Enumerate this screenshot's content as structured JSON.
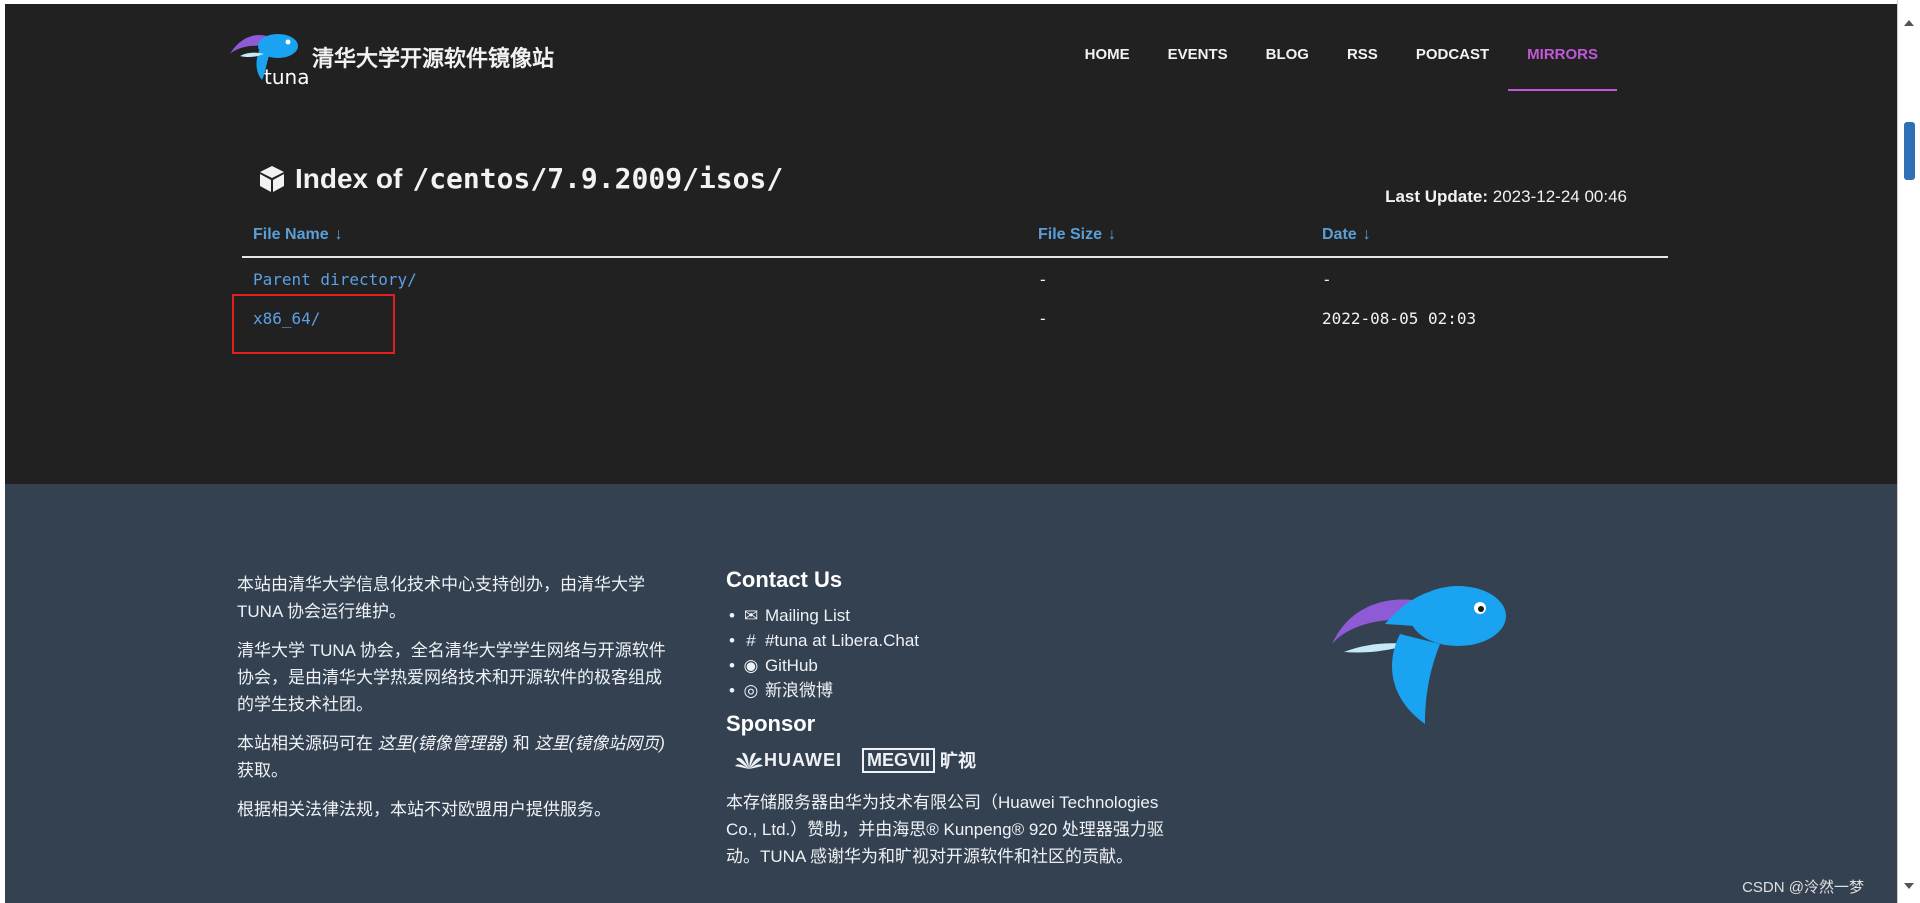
{
  "header": {
    "brand_title": "清华大学开源软件镜像站",
    "logo_text": "tuna",
    "nav": [
      {
        "label": "HOME"
      },
      {
        "label": "EVENTS"
      },
      {
        "label": "BLOG"
      },
      {
        "label": "RSS"
      },
      {
        "label": "PODCAST"
      },
      {
        "label": "MIRRORS",
        "active": true
      }
    ]
  },
  "index": {
    "label": "Index of",
    "path": "/centos/7.9.2009/isos/",
    "last_update_label": "Last Update:",
    "last_update_value": "2023-12-24 00:46"
  },
  "table": {
    "columns": [
      "File Name",
      "File Size",
      "Date"
    ],
    "sort_arrow": "↓",
    "rows": [
      {
        "name": "Parent directory/",
        "size": "-",
        "date": "-"
      },
      {
        "name": "x86_64/",
        "size": "-",
        "date": "2022-08-05 02:03"
      }
    ]
  },
  "footer": {
    "about": {
      "p1": "本站由清华大学信息化技术中心支持创办，由清华大学 TUNA 协会运行维护。",
      "p2": "清华大学 TUNA 协会，全名清华大学学生网络与开源软件协会，是由清华大学热爱网络技术和开源软件的极客组成的学生技术社团。",
      "p3_prefix": "本站相关源码可在",
      "p3_link1": "这里(镜像管理器)",
      "p3_and": "和",
      "p3_link2": "这里(镜像站网页)",
      "p3_suffix": "获取。",
      "p4": "根据相关法律法规，本站不对欧盟用户提供服务。"
    },
    "contact": {
      "title": "Contact Us",
      "items": [
        {
          "icon": "envelope-icon",
          "label": "Mailing List"
        },
        {
          "icon": "hashtag-icon",
          "label": "#tuna at Libera.Chat"
        },
        {
          "icon": "github-icon",
          "label": "GitHub"
        },
        {
          "icon": "weibo-icon",
          "label": "新浪微博"
        }
      ]
    },
    "sponsor": {
      "title": "Sponsor",
      "huawei": "HUAWEI",
      "megvii": "MEGVII",
      "megvii_cn": "旷视",
      "text": "本存储服务器由华为技术有限公司（Huawei Technologies Co., Ltd.）赞助，并由海思® Kunpeng® 920 处理器强力驱动。TUNA 感谢华为和旷视对开源软件和社区的贡献。"
    },
    "watermark": "CSDN @泠然一梦"
  },
  "colors": {
    "top_bg": "#212121",
    "footer_bg": "#344150",
    "accent": "#c158d8",
    "link": "#5aa0e6",
    "highlight": "#e02020"
  }
}
